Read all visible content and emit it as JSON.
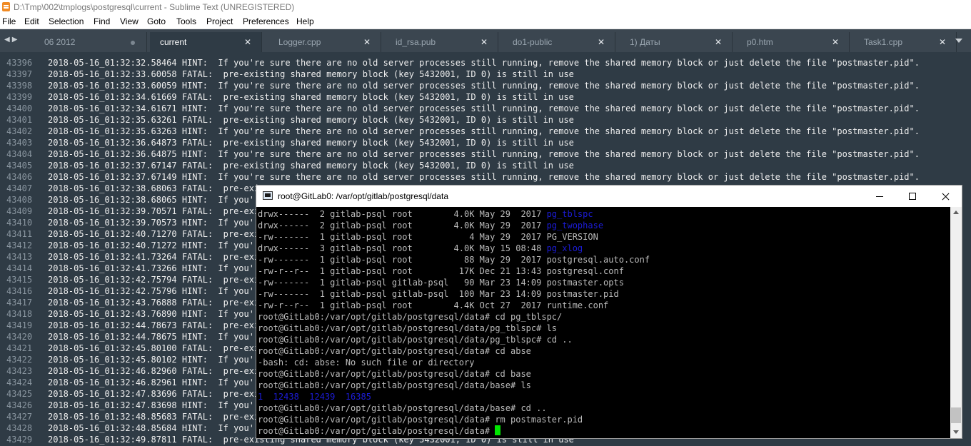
{
  "window": {
    "title": "D:\\Tmp\\002\\tmplogs\\postgresql\\current - Sublime Text (UNREGISTERED)"
  },
  "menu": [
    "File",
    "Edit",
    "Selection",
    "Find",
    "View",
    "Goto",
    "Tools",
    "Project",
    "Preferences",
    "Help"
  ],
  "tabs": [
    {
      "label": "06 2012",
      "active": false,
      "marker": "dot"
    },
    {
      "label": "current",
      "active": true,
      "marker": "close"
    },
    {
      "label": "Logger.cpp",
      "active": false,
      "marker": "close"
    },
    {
      "label": "id_rsa.pub",
      "active": false,
      "marker": "close"
    },
    {
      "label": "do1-public",
      "active": false,
      "marker": "close"
    },
    {
      "label": "1) Даты",
      "active": false,
      "marker": "close"
    },
    {
      "label": "p0.htm",
      "active": false,
      "marker": "close"
    },
    {
      "label": "Task1.cpp",
      "active": false,
      "marker": "close"
    }
  ],
  "editor": {
    "lines": [
      {
        "n": "43396",
        "t": "2018-05-16_01:32:32.58464 HINT:  If you're sure there are no old server processes still running, remove the shared memory block or just delete the file \"postmaster.pid\"."
      },
      {
        "n": "43397",
        "t": "2018-05-16_01:32:33.60058 FATAL:  pre-existing shared memory block (key 5432001, ID 0) is still in use"
      },
      {
        "n": "43398",
        "t": "2018-05-16_01:32:33.60059 HINT:  If you're sure there are no old server processes still running, remove the shared memory block or just delete the file \"postmaster.pid\"."
      },
      {
        "n": "43399",
        "t": "2018-05-16_01:32:34.61669 FATAL:  pre-existing shared memory block (key 5432001, ID 0) is still in use"
      },
      {
        "n": "43400",
        "t": "2018-05-16_01:32:34.61671 HINT:  If you're sure there are no old server processes still running, remove the shared memory block or just delete the file \"postmaster.pid\"."
      },
      {
        "n": "43401",
        "t": "2018-05-16_01:32:35.63261 FATAL:  pre-existing shared memory block (key 5432001, ID 0) is still in use"
      },
      {
        "n": "43402",
        "t": "2018-05-16_01:32:35.63263 HINT:  If you're sure there are no old server processes still running, remove the shared memory block or just delete the file \"postmaster.pid\"."
      },
      {
        "n": "43403",
        "t": "2018-05-16_01:32:36.64873 FATAL:  pre-existing shared memory block (key 5432001, ID 0) is still in use"
      },
      {
        "n": "43404",
        "t": "2018-05-16_01:32:36.64875 HINT:  If you're sure there are no old server processes still running, remove the shared memory block or just delete the file \"postmaster.pid\"."
      },
      {
        "n": "43405",
        "t": "2018-05-16_01:32:37.67147 FATAL:  pre-existing shared memory block (key 5432001, ID 0) is still in use"
      },
      {
        "n": "43406",
        "t": "2018-05-16_01:32:37.67149 HINT:  If you're sure there are no old server processes still running, remove the shared memory block or just delete the file \"postmaster.pid\"."
      },
      {
        "n": "43407",
        "t": "2018-05-16_01:32:38.68063 FATAL:  pre-exi"
      },
      {
        "n": "43408",
        "t": "2018-05-16_01:32:38.68065 HINT:  If you'r"
      },
      {
        "n": "43409",
        "t": "2018-05-16_01:32:39.70571 FATAL:  pre-exi"
      },
      {
        "n": "43410",
        "t": "2018-05-16_01:32:39.70573 HINT:  If you'r"
      },
      {
        "n": "43411",
        "t": "2018-05-16_01:32:40.71270 FATAL:  pre-exi"
      },
      {
        "n": "43412",
        "t": "2018-05-16_01:32:40.71272 HINT:  If you'r"
      },
      {
        "n": "43413",
        "t": "2018-05-16_01:32:41.73264 FATAL:  pre-exi"
      },
      {
        "n": "43414",
        "t": "2018-05-16_01:32:41.73266 HINT:  If you'r"
      },
      {
        "n": "43415",
        "t": "2018-05-16_01:32:42.75794 FATAL:  pre-exi"
      },
      {
        "n": "43416",
        "t": "2018-05-16_01:32:42.75796 HINT:  If you'r"
      },
      {
        "n": "43417",
        "t": "2018-05-16_01:32:43.76888 FATAL:  pre-exi"
      },
      {
        "n": "43418",
        "t": "2018-05-16_01:32:43.76890 HINT:  If you'r"
      },
      {
        "n": "43419",
        "t": "2018-05-16_01:32:44.78673 FATAL:  pre-exi"
      },
      {
        "n": "43420",
        "t": "2018-05-16_01:32:44.78675 HINT:  If you'r"
      },
      {
        "n": "43421",
        "t": "2018-05-16_01:32:45.80100 FATAL:  pre-exi"
      },
      {
        "n": "43422",
        "t": "2018-05-16_01:32:45.80102 HINT:  If you'r"
      },
      {
        "n": "43423",
        "t": "2018-05-16_01:32:46.82960 FATAL:  pre-exi"
      },
      {
        "n": "43424",
        "t": "2018-05-16_01:32:46.82961 HINT:  If you'r"
      },
      {
        "n": "43425",
        "t": "2018-05-16_01:32:47.83696 FATAL:  pre-exi"
      },
      {
        "n": "43426",
        "t": "2018-05-16_01:32:47.83698 HINT:  If you'r"
      },
      {
        "n": "43427",
        "t": "2018-05-16_01:32:48.85683 FATAL:  pre-exi"
      },
      {
        "n": "43428",
        "t": "2018-05-16_01:32:48.85684 HINT:  If you'r"
      },
      {
        "n": "43429",
        "t": "2018-05-16_01:32:49.87811 FATAL:  pre-existing shared memory block (key 5432001, ID 0) is still in use"
      }
    ]
  },
  "putty": {
    "title": "root@GitLab0: /var/opt/gitlab/postgresql/data",
    "lines": [
      {
        "text": "drwx------  2 gitlab-psql root        4.0K May 29  2017 ",
        "blue": "pg_tblspc"
      },
      {
        "text": "drwx------  2 gitlab-psql root        4.0K May 29  2017 ",
        "blue": "pg_twophase"
      },
      {
        "text": "-rw-------  1 gitlab-psql root           4 May 29  2017 PG_VERSION",
        "blue": ""
      },
      {
        "text": "drwx------  3 gitlab-psql root        4.0K May 15 08:48 ",
        "blue": "pg_xlog"
      },
      {
        "text": "-rw-------  1 gitlab-psql root          88 May 29  2017 postgresql.auto.conf",
        "blue": ""
      },
      {
        "text": "-rw-r--r--  1 gitlab-psql root         17K Dec 21 13:43 postgresql.conf",
        "blue": ""
      },
      {
        "text": "-rw-------  1 gitlab-psql gitlab-psql   90 Mar 23 14:09 postmaster.opts",
        "blue": ""
      },
      {
        "text": "-rw-------  1 gitlab-psql gitlab-psql  100 Mar 23 14:09 postmaster.pid",
        "blue": ""
      },
      {
        "text": "-rw-r--r--  1 gitlab-psql root        4.4K Oct 27  2017 runtime.conf",
        "blue": ""
      },
      {
        "text": "root@GitLab0:/var/opt/gitlab/postgresql/data# cd pg_tblspc/",
        "blue": ""
      },
      {
        "text": "root@GitLab0:/var/opt/gitlab/postgresql/data/pg_tblspc# ls",
        "blue": ""
      },
      {
        "text": "root@GitLab0:/var/opt/gitlab/postgresql/data/pg_tblspc# cd ..",
        "blue": ""
      },
      {
        "text": "root@GitLab0:/var/opt/gitlab/postgresql/data# cd abse",
        "blue": ""
      },
      {
        "text": "-bash: cd: abse: No such file or directory",
        "blue": ""
      },
      {
        "text": "root@GitLab0:/var/opt/gitlab/postgresql/data# cd base",
        "blue": ""
      },
      {
        "text": "root@GitLab0:/var/opt/gitlab/postgresql/data/base# ls",
        "blue": ""
      },
      {
        "text": "",
        "blue": "1  12438  12439  16385"
      },
      {
        "text": "root@GitLab0:/var/opt/gitlab/postgresql/data/base# cd ..",
        "blue": ""
      },
      {
        "text": "root@GitLab0:/var/opt/gitlab/postgresql/data# rm postmaster.pid",
        "blue": ""
      },
      {
        "text": "root@GitLab0:/var/opt/gitlab/postgresql/data# ",
        "blue": "",
        "cursor": true
      }
    ]
  },
  "colors": {
    "editor_bg": "#2f3b45",
    "terminal_bg": "#000000",
    "terminal_fg": "#bbbbbb",
    "terminal_dir": "#1c1cd8",
    "cursor": "#00e600",
    "app_icon": "#f08a24"
  }
}
